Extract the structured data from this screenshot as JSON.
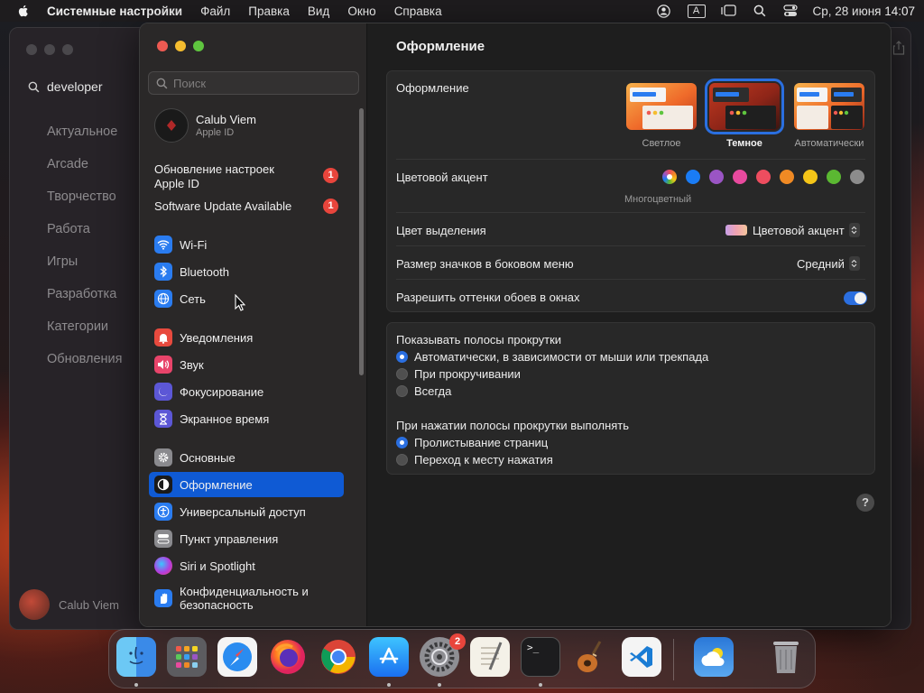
{
  "menubar": {
    "app_name": "Системные настройки",
    "menus": [
      "Файл",
      "Правка",
      "Вид",
      "Окно",
      "Справка"
    ],
    "input_source": "A",
    "clock": "Ср, 28 июня  14:07"
  },
  "background_app": {
    "search_value": "developer",
    "nav_items": [
      "Актуальное",
      "Arcade",
      "Творчество",
      "Работа",
      "Игры",
      "Разработка",
      "Категории",
      "Обновления"
    ],
    "user_name": "Calub Viem"
  },
  "sidebar": {
    "search_placeholder": "Поиск",
    "account": {
      "name": "Calub Viem",
      "subtitle": "Apple ID"
    },
    "updates": [
      {
        "label": "Обновление настроек Apple ID",
        "line1": "Обновление настроек",
        "line2": "Apple ID",
        "badge": "1"
      },
      {
        "label": "Software Update Available",
        "badge": "1"
      }
    ],
    "items": [
      {
        "label": "Wi-Fi",
        "icon": "wifi-icon",
        "color": "#2a7cf0"
      },
      {
        "label": "Bluetooth",
        "icon": "bluetooth-icon",
        "color": "#2a7cf0"
      },
      {
        "label": "Сеть",
        "icon": "globe-icon",
        "color": "#2a7cf0"
      },
      {
        "label": "Уведомления",
        "icon": "bell-icon",
        "color": "#e84a3e"
      },
      {
        "label": "Звук",
        "icon": "speaker-icon",
        "color": "#e8446a"
      },
      {
        "label": "Фокусирование",
        "icon": "moon-icon",
        "color": "#5c57d6"
      },
      {
        "label": "Экранное время",
        "icon": "hourglass-icon",
        "color": "#5c57d6"
      },
      {
        "label": "Основные",
        "icon": "gear-icon",
        "color": "#8a8a8e"
      },
      {
        "label": "Оформление",
        "icon": "appearance-icon",
        "color": "#1a1a1a"
      },
      {
        "label": "Универсальный доступ",
        "icon": "accessibility-icon",
        "color": "#2a7cf0"
      },
      {
        "label": "Пункт управления",
        "icon": "control-center-icon",
        "color": "#8a8a8e"
      },
      {
        "label": "Siri и Spotlight",
        "icon": "siri-icon",
        "color": "#b23ee0"
      },
      {
        "label": "Конфиденциальность и безопасность",
        "line1": "Конфиденциальность и",
        "line2": "безопасность",
        "icon": "hand-icon",
        "color": "#2a7cf0"
      }
    ],
    "selected": "Оформление"
  },
  "content": {
    "title": "Оформление",
    "appearance": {
      "label": "Оформление",
      "options": [
        {
          "label": "Светлое",
          "selected": false
        },
        {
          "label": "Темное",
          "selected": true
        },
        {
          "label": "Автоматически",
          "selected": false
        }
      ]
    },
    "accent": {
      "label": "Цветовой акцент",
      "selected_label": "Многоцветный",
      "colors": [
        "multicolor",
        "#1a7cf5",
        "#9a55c4",
        "#e84a9e",
        "#ee4d5f",
        "#f08a24",
        "#f5c518",
        "#5bb832",
        "#8c8c8c"
      ]
    },
    "highlight": {
      "label": "Цвет выделения",
      "value": "Цветовой акцент"
    },
    "icon_size": {
      "label": "Размер значков в боковом меню",
      "value": "Средний"
    },
    "wallpaper_tint": {
      "label": "Разрешить оттенки обоев в окнах",
      "enabled": true
    },
    "scrollbars": {
      "label": "Показывать полосы прокрутки",
      "options": [
        "Автоматически, в зависимости от мыши или трекпада",
        "При прокручивании",
        "Всегда"
      ],
      "selected": 0
    },
    "scroll_click": {
      "label": "При нажатии полосы прокрутки выполнять",
      "options": [
        "Пролистывание страниц",
        "Переход к месту нажатия"
      ],
      "selected": 0
    },
    "help_label": "?"
  },
  "dock": {
    "apps": [
      "Finder",
      "Launchpad",
      "Safari",
      "Firefox",
      "Chrome",
      "App Store",
      "System Settings",
      "TextEdit",
      "Terminal",
      "GarageBand",
      "Visual Studio Code",
      "Weather",
      "Trash"
    ],
    "system_settings_badge": "2",
    "terminal_glyph": ">_"
  }
}
